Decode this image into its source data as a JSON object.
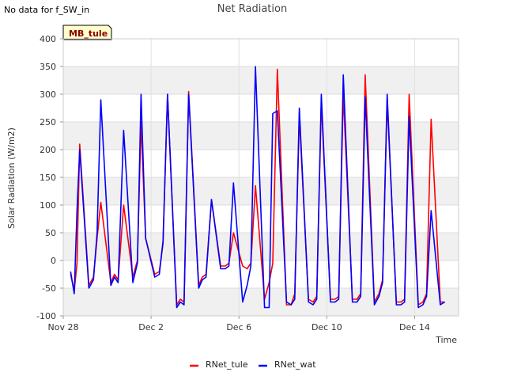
{
  "note": "No data for f_SW_in",
  "site_label": "MB_tule",
  "chart_data": {
    "type": "line",
    "title": "Net Radiation",
    "xlabel": "Time",
    "ylabel": "Solar Radiation (W/m2)",
    "ylim": [
      -100,
      400
    ],
    "yticks": [
      -100,
      -50,
      0,
      50,
      100,
      150,
      200,
      250,
      300,
      350,
      400
    ],
    "xlim": [
      "2023-11-28",
      "2023-12-16"
    ],
    "xticks": [
      {
        "date": "2023-11-28",
        "label": "Nov 28"
      },
      {
        "date": "2023-12-02",
        "label": "Dec 2"
      },
      {
        "date": "2023-12-06",
        "label": "Dec 6"
      },
      {
        "date": "2023-12-10",
        "label": "Dec 10"
      },
      {
        "date": "2023-12-14",
        "label": "Dec 14"
      }
    ],
    "grid": "horizontal bands",
    "legend": "bottom-center",
    "series": [
      {
        "name": "RNet_tule",
        "color": "#ff0000",
        "x": [
          "2023-11-28T08:00",
          "2023-11-28T12:00",
          "2023-11-28T15:00",
          "2023-11-28T18:00",
          "2023-11-29T04:00",
          "2023-11-29T09:00",
          "2023-11-29T13:00",
          "2023-11-29T17:00",
          "2023-11-30T04:00",
          "2023-11-30T08:00",
          "2023-11-30T12:00",
          "2023-11-30T18:00",
          "2023-12-01T04:00",
          "2023-12-01T09:00",
          "2023-12-01T13:00",
          "2023-12-01T18:00",
          "2023-12-02T04:00",
          "2023-12-02T09:00",
          "2023-12-02T13:00",
          "2023-12-02T18:00",
          "2023-12-03T04:00",
          "2023-12-03T08:00",
          "2023-12-03T12:00",
          "2023-12-03T17:00",
          "2023-12-04T04:00",
          "2023-12-04T08:00",
          "2023-12-04T12:00",
          "2023-12-04T18:00",
          "2023-12-05T04:00",
          "2023-12-05T09:00",
          "2023-12-05T13:00",
          "2023-12-05T18:00",
          "2023-12-06T04:00",
          "2023-12-06T09:00",
          "2023-12-06T13:00",
          "2023-12-06T18:00",
          "2023-12-07T04:00",
          "2023-12-07T09:00",
          "2023-12-07T13:00",
          "2023-12-07T18:00",
          "2023-12-08T04:00",
          "2023-12-08T09:00",
          "2023-12-08T13:00",
          "2023-12-08T18:00",
          "2023-12-09T04:00",
          "2023-12-09T09:00",
          "2023-12-09T13:00",
          "2023-12-09T18:00",
          "2023-12-10T04:00",
          "2023-12-10T09:00",
          "2023-12-10T13:00",
          "2023-12-10T18:00",
          "2023-12-11T04:00",
          "2023-12-11T09:00",
          "2023-12-11T13:00",
          "2023-12-11T18:00",
          "2023-12-12T04:00",
          "2023-12-12T09:00",
          "2023-12-12T13:00",
          "2023-12-12T18:00",
          "2023-12-13T04:00",
          "2023-12-13T09:00",
          "2023-12-13T13:00",
          "2023-12-13T18:00",
          "2023-12-14T04:00",
          "2023-12-14T09:00",
          "2023-12-14T13:00",
          "2023-12-14T18:00",
          "2023-12-15T04:00",
          "2023-12-15T09:00"
        ],
        "y": [
          -25,
          -55,
          -5,
          210,
          -45,
          -30,
          40,
          105,
          -40,
          -25,
          -35,
          100,
          -30,
          0,
          250,
          40,
          -25,
          -20,
          30,
          300,
          -80,
          -70,
          -75,
          305,
          -45,
          -30,
          -25,
          110,
          -10,
          -10,
          -5,
          50,
          -10,
          -15,
          -5,
          135,
          -70,
          -40,
          -5,
          345,
          -80,
          -80,
          -60,
          260,
          -70,
          -75,
          -65,
          285,
          -70,
          -70,
          -65,
          300,
          -70,
          -70,
          -60,
          335,
          -75,
          -60,
          -35,
          290,
          -75,
          -75,
          -70,
          300,
          -80,
          -75,
          -60,
          255,
          -75,
          -75
        ]
      },
      {
        "name": "RNet_wat",
        "color": "#0000ff",
        "x": [
          "2023-11-28T08:00",
          "2023-11-28T12:00",
          "2023-11-28T15:00",
          "2023-11-28T18:00",
          "2023-11-29T04:00",
          "2023-11-29T09:00",
          "2023-11-29T13:00",
          "2023-11-29T17:00",
          "2023-11-30T04:00",
          "2023-11-30T08:00",
          "2023-11-30T12:00",
          "2023-11-30T18:00",
          "2023-12-01T04:00",
          "2023-12-01T09:00",
          "2023-12-01T13:00",
          "2023-12-01T18:00",
          "2023-12-02T04:00",
          "2023-12-02T09:00",
          "2023-12-02T13:00",
          "2023-12-02T18:00",
          "2023-12-03T04:00",
          "2023-12-03T08:00",
          "2023-12-03T12:00",
          "2023-12-03T17:00",
          "2023-12-04T04:00",
          "2023-12-04T08:00",
          "2023-12-04T12:00",
          "2023-12-04T18:00",
          "2023-12-05T04:00",
          "2023-12-05T09:00",
          "2023-12-05T13:00",
          "2023-12-05T18:00",
          "2023-12-06T04:00",
          "2023-12-06T09:00",
          "2023-12-06T13:00",
          "2023-12-06T18:00",
          "2023-12-07T04:00",
          "2023-12-07T09:00",
          "2023-12-07T13:00",
          "2023-12-07T18:00",
          "2023-12-08T04:00",
          "2023-12-08T09:00",
          "2023-12-08T13:00",
          "2023-12-08T18:00",
          "2023-12-09T04:00",
          "2023-12-09T09:00",
          "2023-12-09T13:00",
          "2023-12-09T18:00",
          "2023-12-10T04:00",
          "2023-12-10T09:00",
          "2023-12-10T13:00",
          "2023-12-10T18:00",
          "2023-12-11T04:00",
          "2023-12-11T09:00",
          "2023-12-11T13:00",
          "2023-12-11T18:00",
          "2023-12-12T04:00",
          "2023-12-12T09:00",
          "2023-12-12T13:00",
          "2023-12-12T18:00",
          "2023-12-13T04:00",
          "2023-12-13T09:00",
          "2023-12-13T13:00",
          "2023-12-13T18:00",
          "2023-12-14T04:00",
          "2023-12-14T09:00",
          "2023-12-14T13:00",
          "2023-12-14T18:00",
          "2023-12-15T04:00",
          "2023-12-15T09:00"
        ],
        "y": [
          -20,
          -60,
          90,
          200,
          -50,
          -35,
          50,
          290,
          -45,
          -30,
          -40,
          235,
          -40,
          -5,
          300,
          40,
          -30,
          -25,
          35,
          300,
          -85,
          -75,
          -80,
          300,
          -50,
          -35,
          -30,
          110,
          -15,
          -15,
          -10,
          140,
          -75,
          -45,
          -10,
          350,
          -85,
          -85,
          265,
          270,
          -75,
          -80,
          -70,
          275,
          -75,
          -80,
          -70,
          300,
          -75,
          -75,
          -70,
          335,
          -75,
          -75,
          -65,
          295,
          -80,
          -65,
          -40,
          300,
          -80,
          -80,
          -75,
          260,
          -85,
          -80,
          -65,
          90,
          -80,
          -75
        ]
      }
    ]
  }
}
